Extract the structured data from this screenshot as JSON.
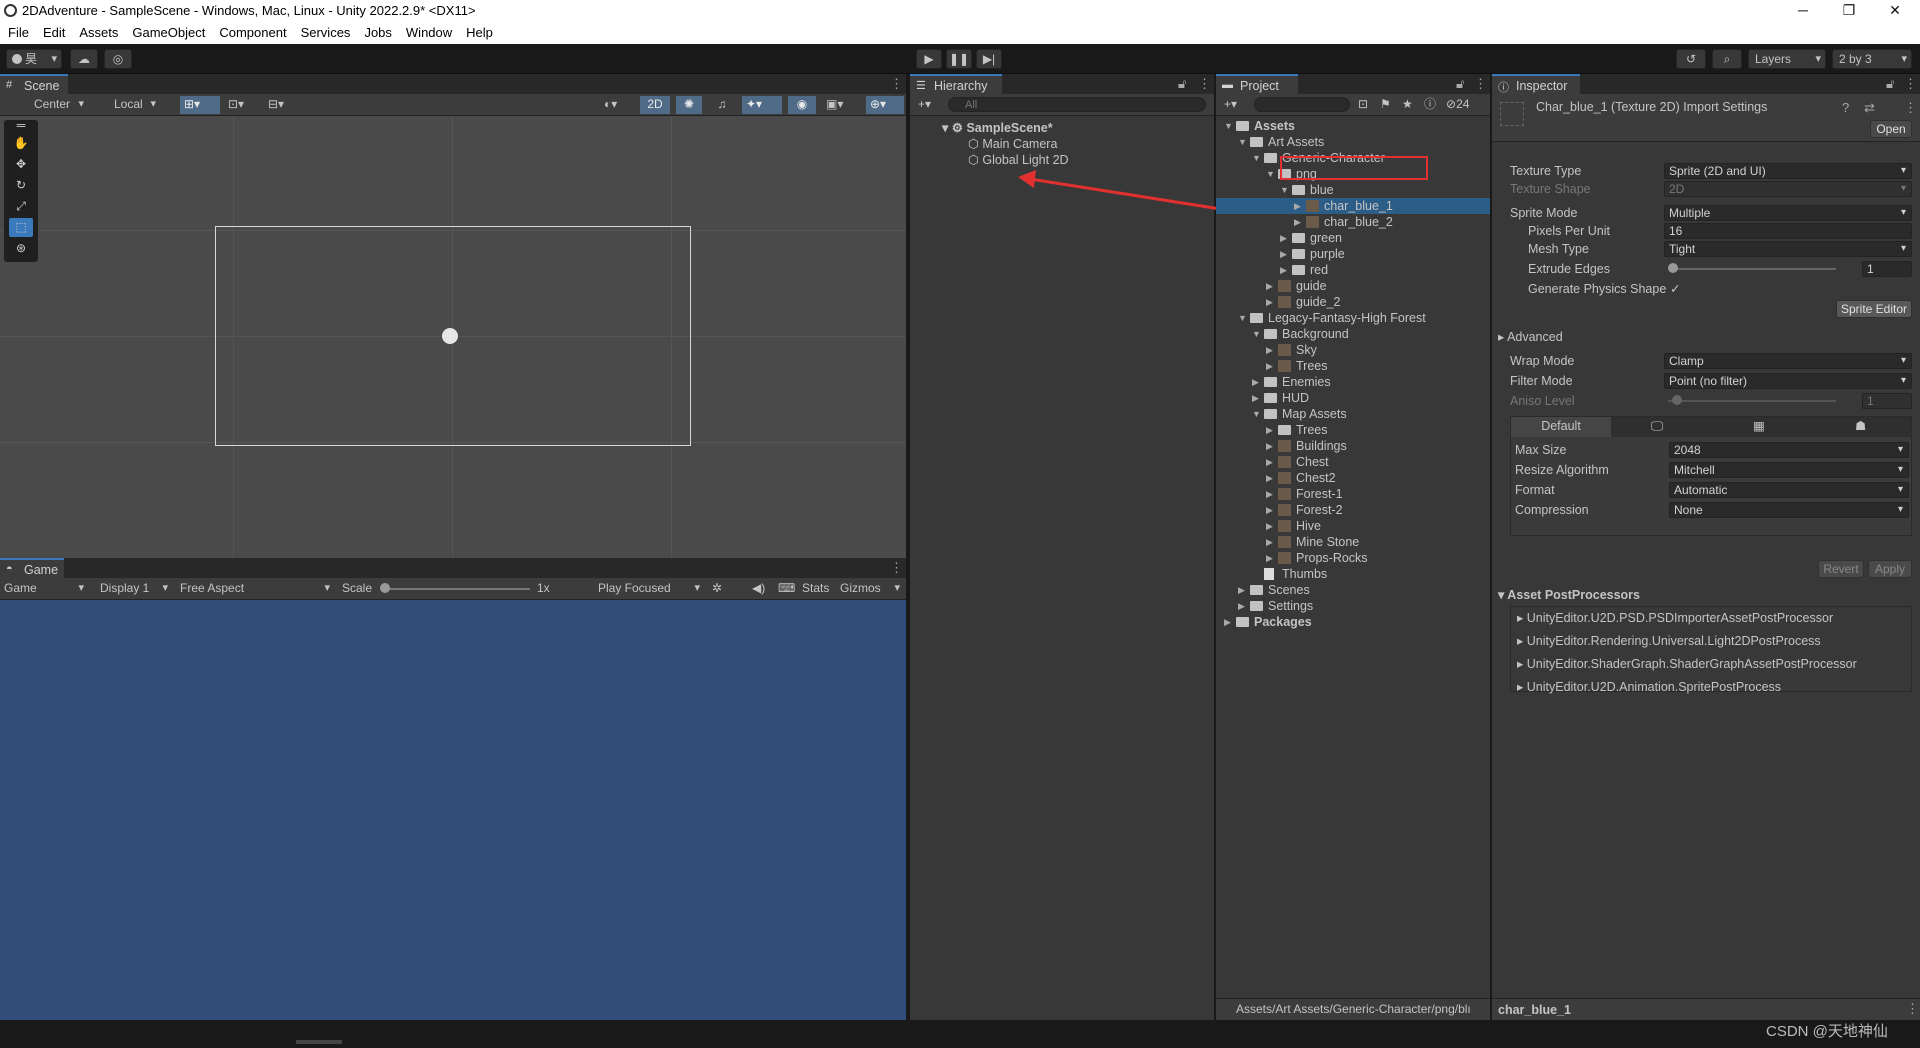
{
  "titlebar": {
    "title": "2DAdventure - SampleScene - Windows, Mac, Linux - Unity 2022.2.9* <DX11>",
    "minimize": "─",
    "maximize": "❐",
    "close": "✕"
  },
  "menu": [
    "File",
    "Edit",
    "Assets",
    "GameObject",
    "Component",
    "Services",
    "Jobs",
    "Window",
    "Help"
  ],
  "toolbar": {
    "account": "昊",
    "layers": "Layers",
    "layout": "2 by 3"
  },
  "scene": {
    "tab": "Scene",
    "pivot": "Center",
    "space": "Local",
    "mode2d": "2D"
  },
  "game": {
    "tab": "Game",
    "view": "Game",
    "display": "Display 1",
    "aspect": "Free Aspect",
    "scale_label": "Scale",
    "scale_value": "1x",
    "play_mode": "Play Focused",
    "stats": "Stats",
    "gizmos": "Gizmos"
  },
  "hierarchy": {
    "tab": "Hierarchy",
    "search_placeholder": "All",
    "scene": "SampleScene*",
    "items": [
      "Main Camera",
      "Global Light 2D"
    ]
  },
  "project": {
    "tab": "Project",
    "hidden_count": "24",
    "path": "Assets/Art Assets/Generic-Character/png/blı",
    "tree": [
      "Assets",
      "Art Assets",
      "Generic-Character",
      "png",
      "blue",
      "char_blue_1",
      "char_blue_2",
      "green",
      "purple",
      "red",
      "guide",
      "guide_2",
      "Legacy-Fantasy-High Forest",
      "Background",
      "Sky",
      "Trees",
      "Enemies",
      "HUD",
      "Map Assets",
      "Trees",
      "Buildings",
      "Chest",
      "Chest2",
      "Forest-1",
      "Forest-2",
      "Hive",
      "Mine Stone",
      "Props-Rocks",
      "Thumbs",
      "Scenes",
      "Settings",
      "Packages"
    ]
  },
  "inspector": {
    "tab": "Inspector",
    "title": "Char_blue_1 (Texture 2D) Import Settings",
    "open": "Open",
    "labels": {
      "texture_type": "Texture Type",
      "texture_shape": "Texture Shape",
      "sprite_mode": "Sprite Mode",
      "ppu": "Pixels Per Unit",
      "mesh_type": "Mesh Type",
      "extrude": "Extrude Edges",
      "gen_physics": "Generate Physics Shape",
      "advanced": "Advanced",
      "wrap": "Wrap Mode",
      "filter": "Filter Mode",
      "aniso": "Aniso Level",
      "max_size": "Max Size",
      "resize": "Resize Algorithm",
      "format": "Format",
      "compression": "Compression"
    },
    "values": {
      "texture_type": "Sprite (2D and UI)",
      "texture_shape": "2D",
      "sprite_mode": "Multiple",
      "ppu": "16",
      "mesh_type": "Tight",
      "extrude": "1",
      "gen_physics_check": "✓",
      "wrap": "Clamp",
      "filter": "Point (no filter)",
      "aniso": "1",
      "max_size": "2048",
      "resize": "Mitchell",
      "format": "Automatic",
      "compression": "None"
    },
    "sprite_editor": "Sprite Editor",
    "platform_default": "Default",
    "revert": "Revert",
    "apply": "Apply",
    "postprocessors_header": "Asset PostProcessors",
    "postprocessors": [
      "UnityEditor.U2D.PSD.PSDImporterAssetPostProcessor",
      "UnityEditor.Rendering.Universal.Light2DPostProcess",
      "UnityEditor.ShaderGraph.ShaderGraphAssetPostProcessor",
      "UnityEditor.U2D.Animation.SpritePostProcess"
    ],
    "footer": "char_blue_1"
  },
  "watermark": "CSDN @天地神仙"
}
